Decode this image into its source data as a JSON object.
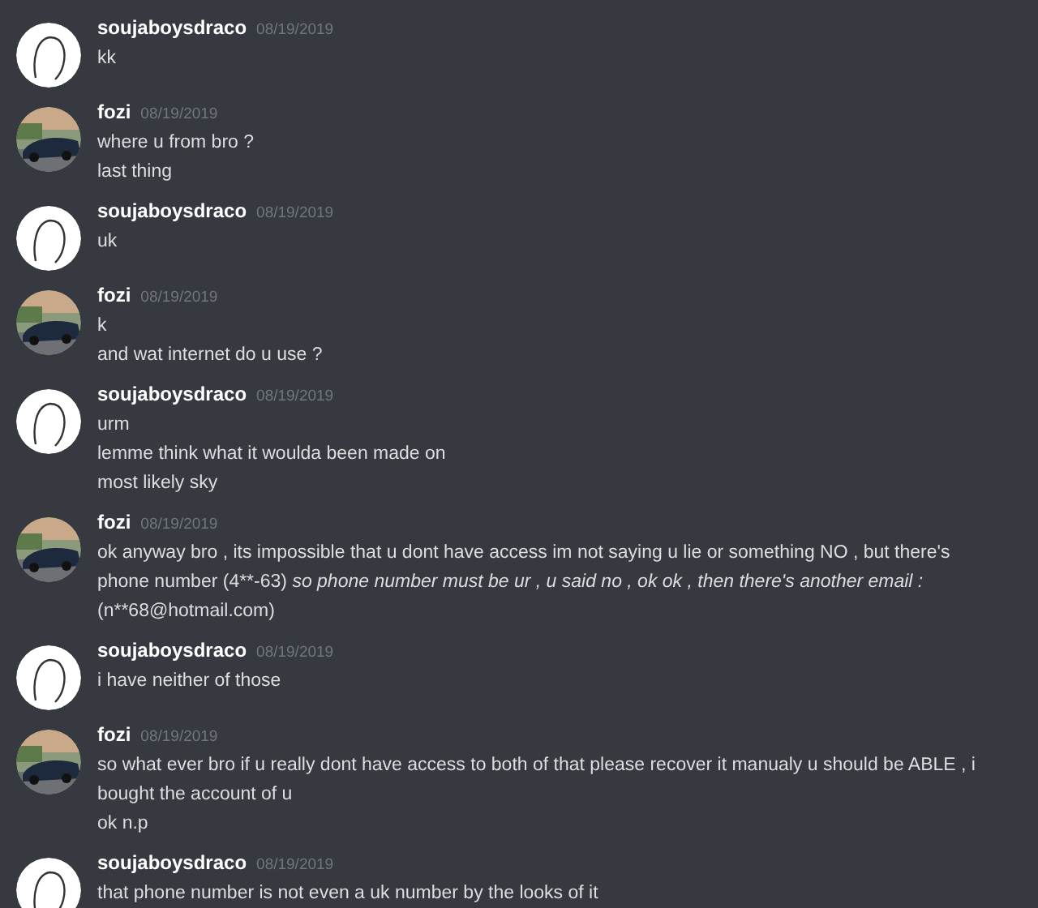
{
  "messages": [
    {
      "author": "soujaboysdraco",
      "kind": "sketch",
      "date": "08/19/2019",
      "lines": [
        [
          {
            "text": "kk"
          }
        ]
      ]
    },
    {
      "author": "fozi",
      "date": "08/19/2019",
      "lines": [
        [
          {
            "text": "where u from bro ?"
          }
        ],
        [
          {
            "text": "last thing"
          }
        ]
      ]
    },
    {
      "author": "soujaboysdraco",
      "kind": "sketch",
      "date": "08/19/2019",
      "lines": [
        [
          {
            "text": "uk"
          }
        ]
      ]
    },
    {
      "author": "fozi",
      "date": "08/19/2019",
      "lines": [
        [
          {
            "text": "k"
          }
        ],
        [
          {
            "text": "and wat internet do u use ?"
          }
        ]
      ]
    },
    {
      "author": "soujaboysdraco",
      "kind": "sketch",
      "date": "08/19/2019",
      "lines": [
        [
          {
            "text": "urm"
          }
        ],
        [
          {
            "text": "lemme think what it woulda been made on"
          }
        ],
        [
          {
            "text": "most likely sky"
          }
        ]
      ]
    },
    {
      "author": "fozi",
      "date": "08/19/2019",
      "lines": [
        [
          {
            "text": "ok anyway bro , its impossible that u dont have access im not saying u lie or something NO , but there's phone number (4**-63) "
          },
          {
            "text": "so phone number must be ur , u said no , ok ok , then there's another email  :",
            "italic": true
          },
          {
            "text": " (n**68@hotmail.com)"
          }
        ]
      ]
    },
    {
      "author": "soujaboysdraco",
      "kind": "sketch",
      "date": "08/19/2019",
      "lines": [
        [
          {
            "text": "i have neither of those"
          }
        ]
      ]
    },
    {
      "author": "fozi",
      "date": "08/19/2019",
      "lines": [
        [
          {
            "text": "so what ever bro if u really dont have access to both of that please recover it manualy u should be ABLE , i bought the account of u"
          }
        ],
        [
          {
            "text": "ok n.p"
          }
        ]
      ]
    },
    {
      "author": "soujaboysdraco",
      "kind": "sketch",
      "date": "08/19/2019",
      "lines": [
        [
          {
            "text": "that phone number is not even  a uk number by the looks of it"
          }
        ]
      ]
    }
  ]
}
